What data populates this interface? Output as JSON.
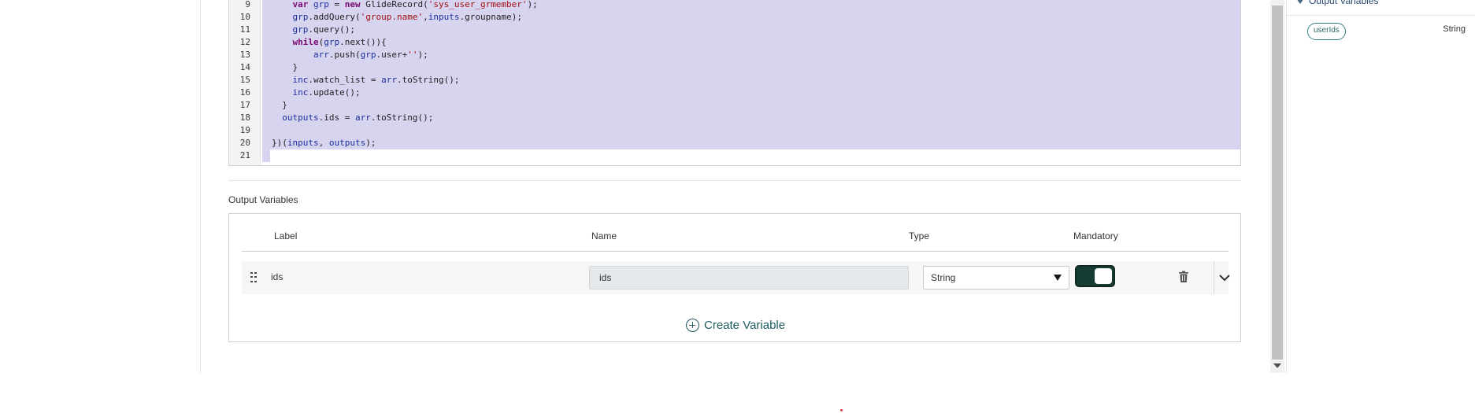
{
  "editor": {
    "line_numbers": [
      "9",
      "10",
      "11",
      "12",
      "13",
      "14",
      "15",
      "16",
      "17",
      "18",
      "19",
      "20",
      "21"
    ],
    "lines": [
      "    var grp = new GlideRecord('sys_user_grmember');",
      "    grp.addQuery('group.name',inputs.groupname);",
      "    grp.query();",
      "    while(grp.next()){",
      "        arr.push(grp.user+'');",
      "    }",
      "    inc.watch_list = arr.toString();",
      "    inc.update();",
      "  }",
      "  outputs.ids = arr.toString();",
      "",
      "})(inputs, outputs);",
      ""
    ]
  },
  "output_variables": {
    "title": "Output Variables",
    "columns": {
      "label": "Label",
      "name": "Name",
      "type": "Type",
      "mandatory": "Mandatory"
    },
    "rows": [
      {
        "label": "ids",
        "name": "ids",
        "type": "String",
        "mandatory": true
      }
    ],
    "create_label": "Create Variable"
  },
  "right_panel": {
    "heading": "Output Variables",
    "items": [
      {
        "name": "userIds",
        "type": "String"
      }
    ]
  },
  "colors": {
    "selection": "#d7d4ef",
    "toggle_on": "#173c33",
    "accent": "#1d5a5e"
  }
}
